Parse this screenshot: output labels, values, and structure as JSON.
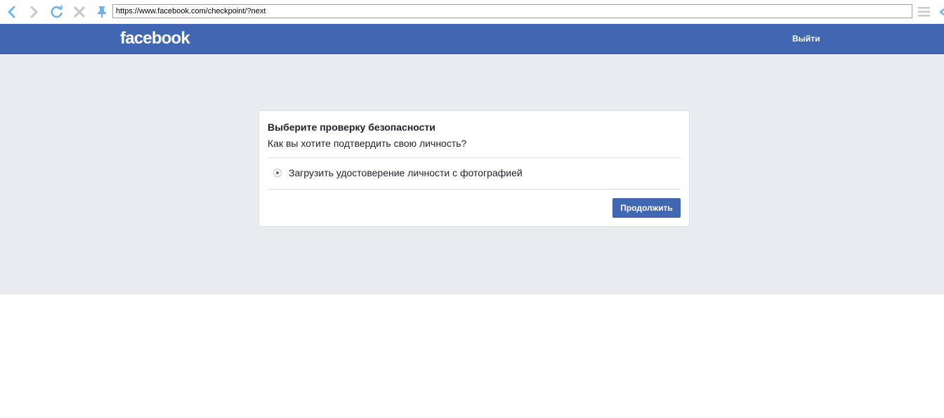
{
  "browser": {
    "url": "https://www.facebook.com/checkpoint/?next",
    "icons": [
      "back-icon",
      "forward-icon",
      "reload-icon",
      "stop-icon",
      "pin-icon",
      "menu-icon"
    ]
  },
  "header": {
    "logo_text": "facebook",
    "logout_label": "Выйти",
    "background_color": "#4267b2"
  },
  "checkpoint": {
    "title": "Выберите проверку безопасности",
    "subtitle": "Как вы хотите подтвердить свою личность?",
    "options": [
      {
        "label": "Загрузить удостоверение личности с фотографией",
        "selected": true
      }
    ],
    "continue_label": "Продолжить"
  },
  "colors": {
    "accent": "#4267b2",
    "page_background": "#e9ebee",
    "browser_icon": "#6cb4f0"
  }
}
